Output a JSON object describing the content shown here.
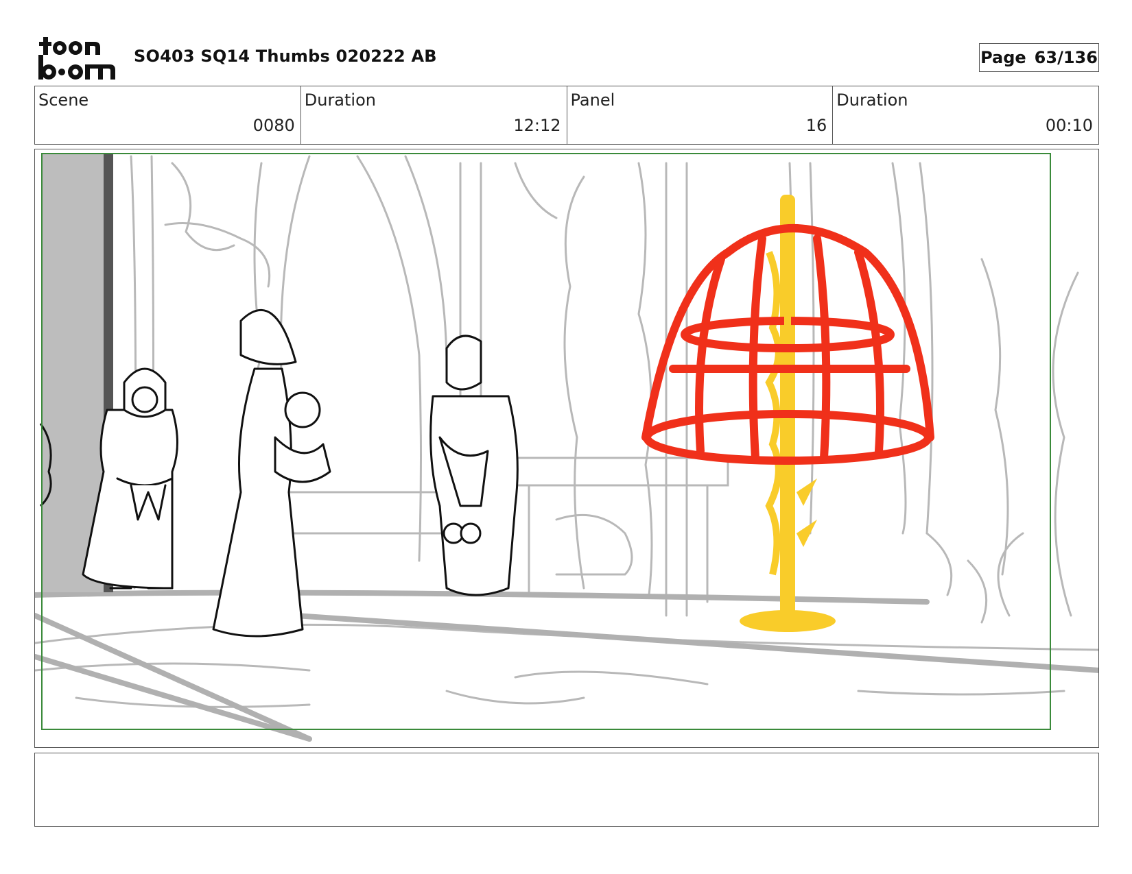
{
  "header": {
    "logo_text": [
      "toon",
      "boom"
    ],
    "title": "SO403 SQ14 Thumbs 020222 AB",
    "page_label": "Page",
    "page_value": "63/136"
  },
  "info": {
    "scene_label": "Scene",
    "scene_value": "0080",
    "duration_label": "Duration",
    "duration_value": "12:12",
    "panel_label": "Panel",
    "panel_value": "16",
    "panel_duration_label": "Duration",
    "panel_duration_value": "00:10"
  },
  "panel": {
    "description": "Storyboard sketch",
    "colors": {
      "safe_frame": "#3a8a3a",
      "background_lines": "#b8b8b8",
      "cage": "#f0301a",
      "pole": "#f9cc2a",
      "ink": "#111111",
      "wall_shadow": "#bdbdbd"
    }
  },
  "notes": {
    "text": ""
  }
}
